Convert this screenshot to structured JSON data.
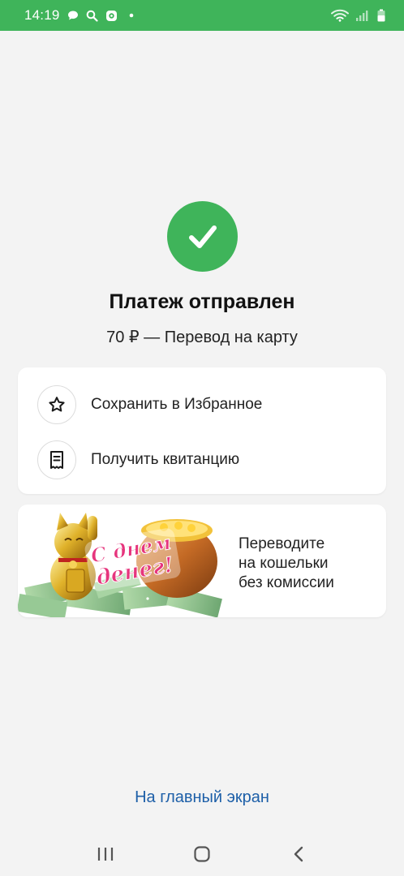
{
  "status_bar": {
    "time": "14:19",
    "left_icons": [
      "chat-bubble-icon",
      "search-icon",
      "shield-app-icon",
      "dot-icon"
    ],
    "right_icons": [
      "wifi-icon",
      "signal-icon",
      "battery-icon"
    ],
    "background": "#3fb45a"
  },
  "result": {
    "icon": "checkmark-icon",
    "title": "Платеж отправлен",
    "subtitle": "70 ₽ — Перевод на карту"
  },
  "actions": [
    {
      "label": "Сохранить в Избранное",
      "icon": "star-icon"
    },
    {
      "label": "Получить квитанцию",
      "icon": "receipt-icon"
    }
  ],
  "promo": {
    "image_caption": "С днем денег!",
    "lines": [
      "Переводите",
      "на кошельки",
      "без комиссии"
    ]
  },
  "home_link": "На главный экран",
  "nav_bar": [
    "recent-apps-icon",
    "home-icon",
    "back-icon"
  ],
  "colors": {
    "accent_green": "#3fb45a",
    "link_blue": "#1d5fa8",
    "background": "#f3f3f3"
  }
}
